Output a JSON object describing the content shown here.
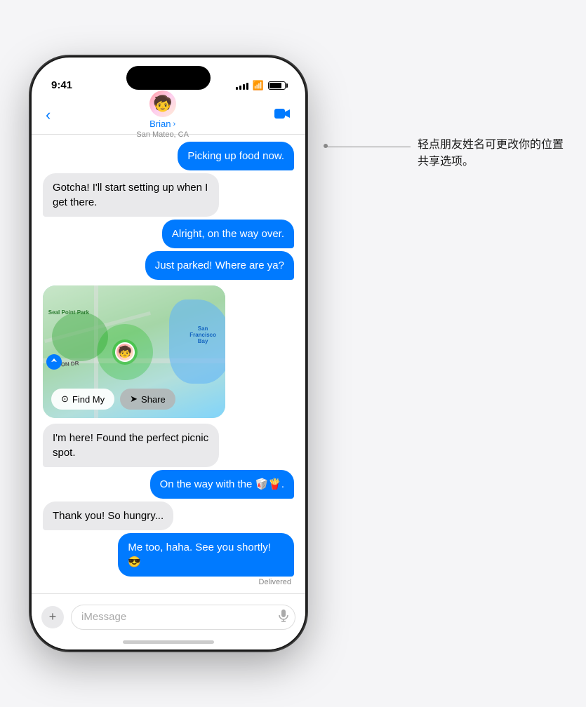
{
  "status_bar": {
    "time": "9:41",
    "signal_bars": [
      4,
      6,
      8,
      10,
      12
    ],
    "battery_level": 80
  },
  "nav": {
    "back_icon": "‹",
    "contact_name": "Brian",
    "contact_chevron": "›",
    "contact_location": "San Mateo, CA",
    "video_icon": "📷"
  },
  "messages": [
    {
      "id": 1,
      "type": "sent",
      "text": "Picking up food now."
    },
    {
      "id": 2,
      "type": "received",
      "text": "Gotcha! I'll start setting up when I get there."
    },
    {
      "id": 3,
      "type": "sent",
      "text": "Alright, on the way over."
    },
    {
      "id": 4,
      "type": "sent",
      "text": "Just parked! Where are ya?"
    },
    {
      "id": 5,
      "type": "map",
      "text": ""
    },
    {
      "id": 6,
      "type": "received",
      "text": "I'm here! Found the perfect picnic spot."
    },
    {
      "id": 7,
      "type": "sent",
      "text": "On the way with the 🥡🍟."
    },
    {
      "id": 8,
      "type": "received",
      "text": "Thank you! So hungry..."
    },
    {
      "id": 9,
      "type": "sent",
      "text": "Me too, haha. See you shortly! 😎"
    }
  ],
  "map": {
    "find_my_label": "Find My",
    "share_label": "Share",
    "find_my_icon": "⊙",
    "share_icon": "➤",
    "park_label": "Seal Point Park",
    "bay_label": "San Francisco Bay",
    "road_label": "INTON DR"
  },
  "delivered_label": "Delivered",
  "input": {
    "placeholder": "iMessage",
    "plus_icon": "+",
    "mic_icon": "🎤"
  },
  "callout": {
    "text": "轻点朋友姓名可更改你的位置共享选项。"
  }
}
